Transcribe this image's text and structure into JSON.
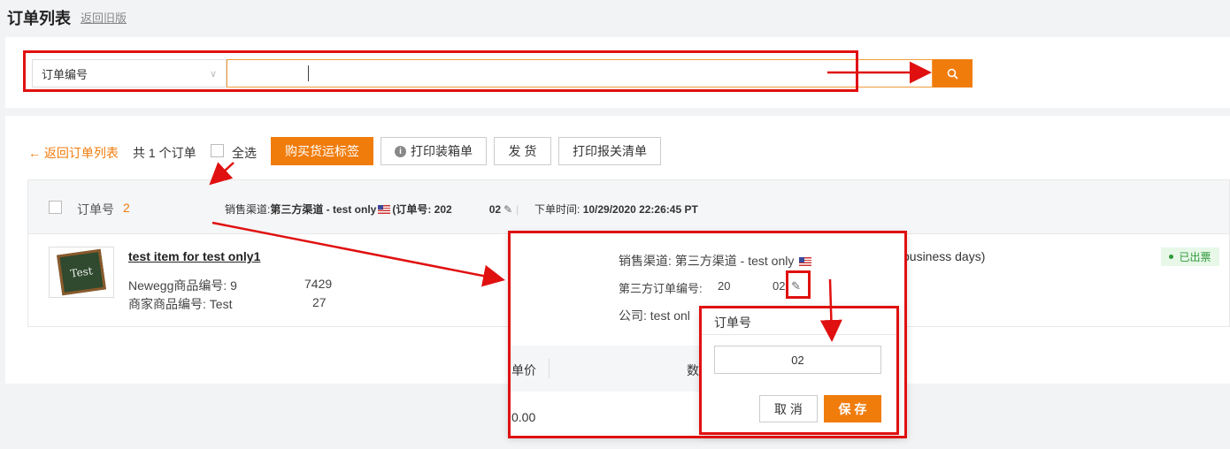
{
  "header": {
    "title": "订单列表",
    "back_old": "返回旧版"
  },
  "search": {
    "field_label": "订单编号",
    "input_value": "",
    "clear_icon": "close-icon",
    "search_icon": "search-icon"
  },
  "toolbar": {
    "back_list": "← 返回订单列表",
    "order_count": "共 1 个订单",
    "select_all": "全选",
    "buy_label": "购买货运标签",
    "print_pack": "打印装箱单",
    "ship": "发 货",
    "print_customs": "打印报关清单"
  },
  "order": {
    "no_label": "订单号",
    "no_value": "2",
    "channel_label": "销售渠道:",
    "channel_value": "第三方渠道 - test only",
    "third_no_label": "(订单号: 202",
    "third_no_tail": "02",
    "date_label": "下单时间:",
    "date_value": "10/29/2020 22:26:45 PT",
    "item_title": "test item  for test only1",
    "newegg_id_label": "Newegg商品编号: 9",
    "newegg_id_tail": "7429",
    "seller_id_label": "商家商品编号: Test",
    "seller_id_tail": "27",
    "thumb_text": "Test",
    "business_days": "business days)",
    "status": "已出票"
  },
  "popover": {
    "channel_label": "销售渠道:",
    "channel_value": "第三方渠道 - test only",
    "third_no_label": "第三方订单编号:",
    "third_no_value": "20",
    "third_no_tail": "02",
    "company_label": "公司:",
    "company_value": "test onl",
    "col_price": "单价",
    "col_qty": "数",
    "price_value": "0.00"
  },
  "edit_dialog": {
    "title": "订单号",
    "input_value": "02",
    "cancel": "取 消",
    "save": "保 存"
  },
  "colors": {
    "accent": "#f07c0c",
    "annotation": "#e01010",
    "status_green": "#2e9a3a"
  }
}
